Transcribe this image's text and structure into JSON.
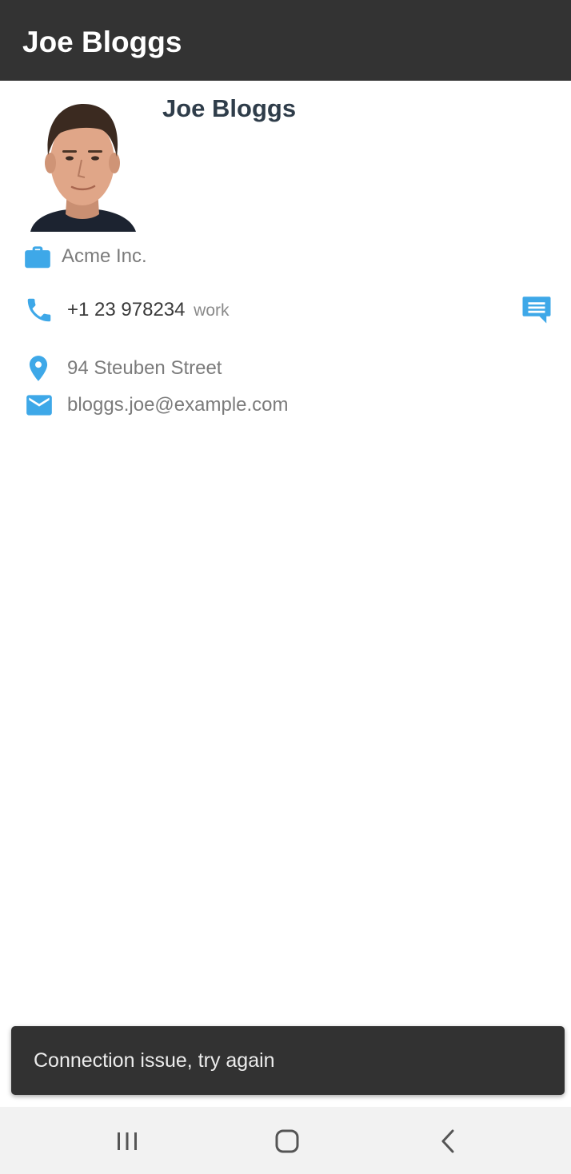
{
  "app_bar": {
    "title": "Joe Bloggs"
  },
  "contact": {
    "name": "Joe Bloggs",
    "company": "Acme Inc.",
    "phone": {
      "number": "+1 23 978234",
      "type": "work"
    },
    "address": "94 Steuben Street",
    "email": "bloggs.joe@example.com"
  },
  "icons": {
    "company": "briefcase-icon",
    "phone": "phone-icon",
    "sms": "message-icon",
    "address": "location-pin-icon",
    "email": "envelope-icon",
    "nav_recents": "recent-apps-icon",
    "nav_home": "home-icon",
    "nav_back": "back-icon"
  },
  "colors": {
    "app_bar": "#333333",
    "accent": "#3ea8e8",
    "name_text": "#2f3d4a",
    "snackbar": "#323232"
  },
  "snackbar": {
    "message": "Connection issue, try again"
  }
}
